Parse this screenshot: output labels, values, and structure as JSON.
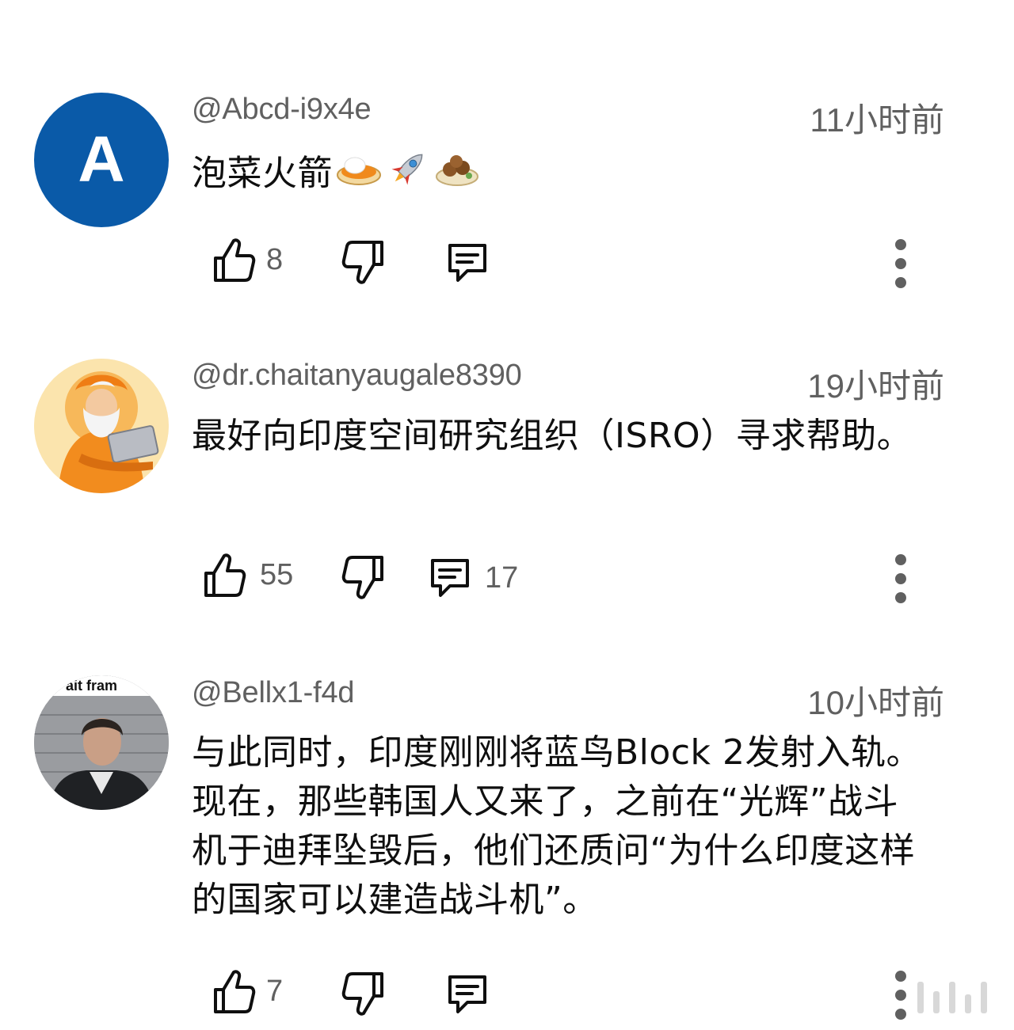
{
  "comments": [
    {
      "author": "@Abcd-i9x4e",
      "time": "11小时前",
      "avatar_letter": "A",
      "text": "泡菜火箭",
      "emojis": [
        "curry-rice-emoji",
        "rocket-emoji",
        "falafel-emoji"
      ],
      "likes": "8",
      "replies": ""
    },
    {
      "author": "@dr.chaitanyaugale8390",
      "time": "19小时前",
      "text": "最好向印度空间研究组织（ISRO）寻求帮助。",
      "likes": "55",
      "replies": "17"
    },
    {
      "author": "@Bellx1-f4d",
      "time": "10小时前",
      "avatar_caption": "ait fram",
      "text": "与此同时，印度刚刚将蓝鸟Block 2发射入轨。现在，那些韩国人又来了，之前在“光辉”战斗机于迪拜坠毁后，他们还质问“为什么印度这样的国家可以建造战斗机”。",
      "likes": "7",
      "replies": ""
    }
  ],
  "colors": {
    "avatar_a_bg": "#0a5aa8",
    "secondary_text": "#606060",
    "primary_text": "#0f0f0f"
  }
}
